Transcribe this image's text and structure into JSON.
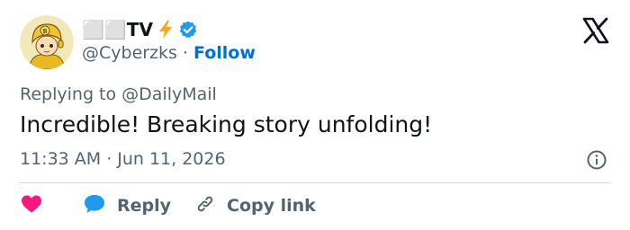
{
  "user": {
    "display_name": "⬜⬜TV",
    "handle": "@Cyberzks",
    "follow_label": "Follow",
    "separator": "·"
  },
  "tweet": {
    "reply_prefix": "Replying to",
    "reply_mention": "@DailyMail",
    "text": "Incredible! Breaking story unfolding!",
    "time": "11:33 AM",
    "date": "Jun 11, 2026",
    "separator": "·"
  },
  "actions": {
    "reply_label": "Reply",
    "copy_link_label": "Copy link"
  },
  "colors": {
    "text_primary": "#0f1419",
    "text_secondary": "#536471",
    "follow_blue": "#006fd6",
    "verified_blue": "#1d9bf0",
    "like_red": "#f91880",
    "bolt_orange": "#f5a623",
    "divider": "#cfd9de"
  },
  "icons": {
    "avatar": "avatar-cartoon-gold-helmet",
    "bolt": "lightning-bolt-icon",
    "verified": "verified-badge-icon",
    "logo": "x-logo-icon",
    "info": "info-icon",
    "like": "heart-icon",
    "reply": "speech-bubble-icon",
    "copy_link": "link-icon"
  }
}
